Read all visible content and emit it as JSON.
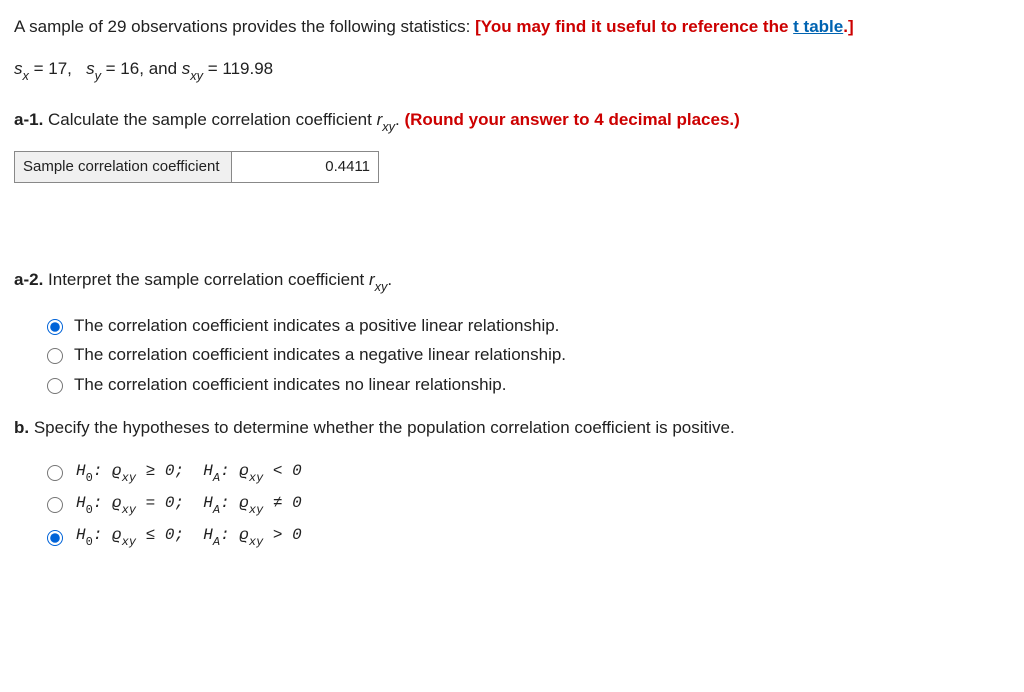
{
  "intro": {
    "prefix": "A sample of 29 observations provides the following statistics: ",
    "bracket_open": "[",
    "hint": "You may find it useful to reference the ",
    "link_text": "t table",
    "period": ".",
    "bracket_close": "]"
  },
  "stats": {
    "sx_label": "s",
    "sx_sub": "x",
    "sx_val": " = 17,",
    "sy_label": "s",
    "sy_sub": "y",
    "sy_val": " = 16,",
    "and": "  and  ",
    "sxy_label": "s",
    "sxy_sub": "xy",
    "sxy_val": " = 119.98"
  },
  "a1": {
    "label": "a-1.",
    "text": " Calculate the sample correlation coefficient ",
    "r": "r",
    "r_sub": "xy",
    "period": ". ",
    "instr": "(Round your answer to 4 decimal places.)",
    "table_label": "Sample correlation coefficient",
    "table_value": "0.4411"
  },
  "a2": {
    "label": "a-2.",
    "text": " Interpret the sample correlation coefficient ",
    "r": "r",
    "r_sub": "xy",
    "period": ".",
    "options": [
      "The correlation coefficient indicates a positive linear relationship.",
      "The correlation coefficient indicates a negative linear relationship.",
      "The correlation coefficient indicates no linear relationship."
    ],
    "selected": 0
  },
  "b": {
    "label": "b.",
    "text": " Specify the hypotheses to determine whether the population correlation coefficient is positive.",
    "hyps": [
      {
        "h0_op": "≥",
        "ha_op": "<"
      },
      {
        "h0_op": "=",
        "ha_op": "≠"
      },
      {
        "h0_op": "≤",
        "ha_op": ">"
      }
    ],
    "selected": 2
  }
}
